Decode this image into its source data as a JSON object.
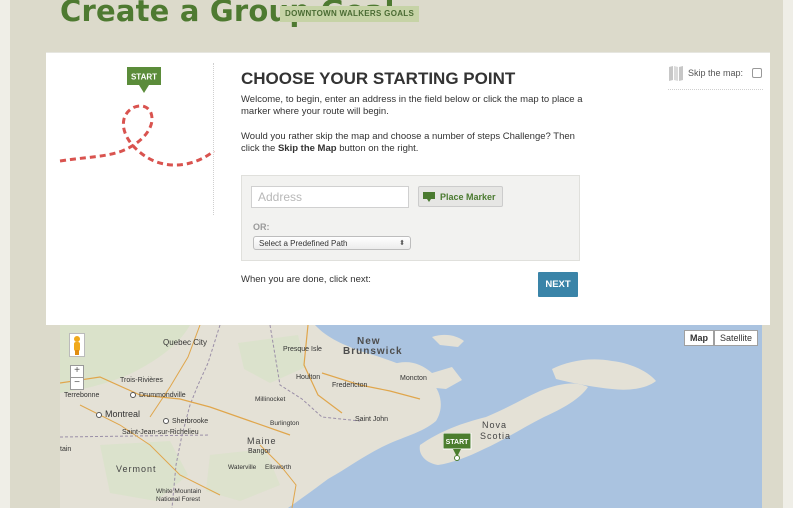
{
  "header": {
    "title": "Create a Group Goal",
    "group_badge": "DOWNTOWN WALKERS GOALS"
  },
  "illustration": {
    "start_flag": "START"
  },
  "starting_point": {
    "heading": "CHOOSE YOUR STARTING POINT",
    "intro": "Welcome, to begin, enter an address in the field below or click the map to place a marker where your route will begin.",
    "skip_question": "Would you rather skip the map and choose a number of steps Challenge? Then click the ",
    "skip_emphasis": "Skip the Map",
    "skip_suffix": " button on the right."
  },
  "skip_map": {
    "label": "Skip the map:",
    "checked": false
  },
  "form": {
    "address_placeholder": "Address",
    "address_value": "",
    "place_marker_label": "Place Marker",
    "or_label": "OR:",
    "predefined_path_selected": "Select a Predefined Path",
    "done_text": "When you are done, click next:",
    "next_label": "NEXT"
  },
  "map": {
    "type_buttons": [
      "Map",
      "Satellite"
    ],
    "active_type": "Map",
    "zoom_in": "+",
    "zoom_out": "−",
    "marker_label": "START",
    "labels": {
      "quebec_city": "Quebec City",
      "presque_isle": "Presque Isle",
      "new_brunswick_1": "New",
      "new_brunswick_2": "Brunswick",
      "houlton": "Houlton",
      "fredericton": "Fredericton",
      "moncton": "Moncton",
      "trois_rivieres": "Trois-Rivières",
      "terrebonne": "Terrebonne",
      "drummondville": "Drummondville",
      "montreal": "Montreal",
      "sherbrooke": "Sherbrooke",
      "saint_jean": "Saint-Jean-sur-Richelieu",
      "millinocket": "Millinocket",
      "burlington": "Burlington",
      "saint_john": "Saint John",
      "maine": "Maine",
      "bangor": "Bangor",
      "nova_scotia_1": "Nova",
      "nova_scotia_2": "Scotia",
      "vermont": "Vermont",
      "waterville": "Waterville",
      "ellsworth": "Ellsworth",
      "white_mountain_1": "White Mountain",
      "white_mountain_2": "National Forest",
      "tain": "tain"
    }
  },
  "colors": {
    "brand_green": "#4e7a31",
    "next_blue": "#3a84a8",
    "route_red": "#d9534f",
    "flag_green": "#5b8c3a"
  }
}
